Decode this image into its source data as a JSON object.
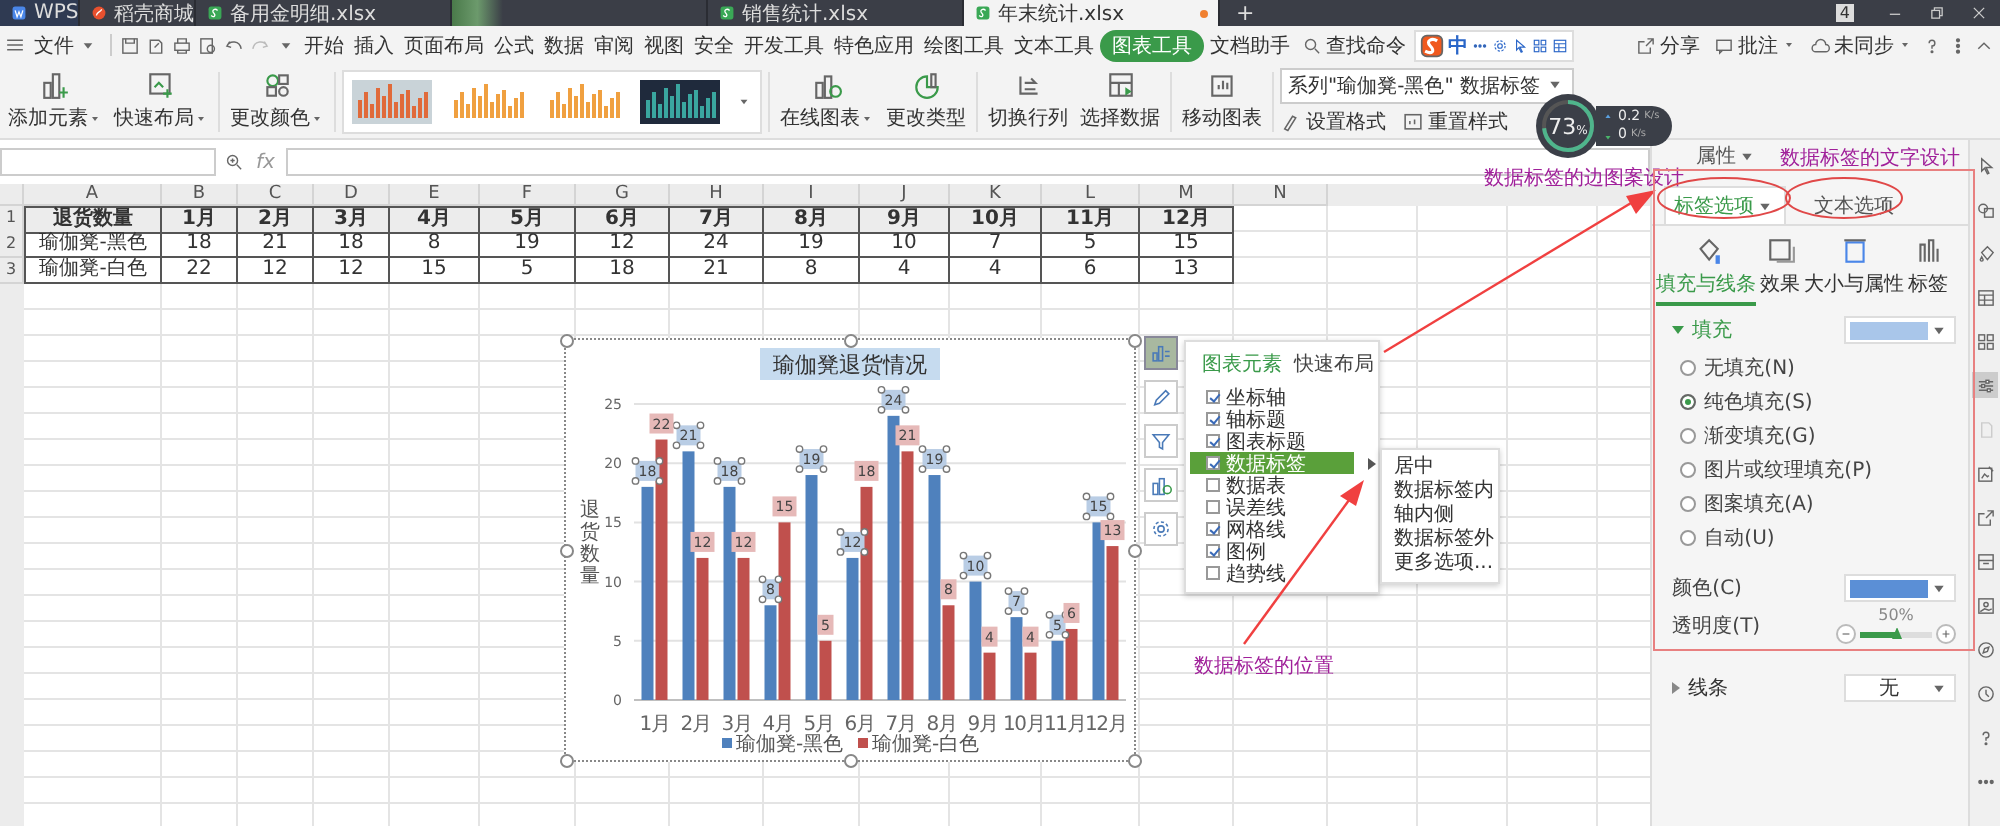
{
  "title_bar": {
    "tabs": [
      {
        "label": "WPS",
        "kind": "wps",
        "selected": false
      },
      {
        "label": "稻壳商城",
        "kind": "shop",
        "selected": false
      },
      {
        "label": "备用金明细.xlsx",
        "kind": "sheet",
        "selected": false
      },
      {
        "kind": "blurred",
        "selected": false
      },
      {
        "label": "销售统计.xlsx",
        "kind": "sheet",
        "selected": false
      },
      {
        "label": "年末统计.xlsx",
        "kind": "sheet",
        "selected": true
      }
    ],
    "new_tab": "+",
    "window_count": "4"
  },
  "menu": {
    "file": "文件",
    "tabs": [
      {
        "label": "开始",
        "selected": false
      },
      {
        "label": "插入",
        "selected": false
      },
      {
        "label": "页面布局",
        "selected": false
      },
      {
        "label": "公式",
        "selected": false
      },
      {
        "label": "数据",
        "selected": false
      },
      {
        "label": "审阅",
        "selected": false
      },
      {
        "label": "视图",
        "selected": false
      },
      {
        "label": "安全",
        "selected": false
      },
      {
        "label": "开发工具",
        "selected": false
      },
      {
        "label": "特色应用",
        "selected": false
      },
      {
        "label": "绘图工具",
        "selected": false
      },
      {
        "label": "文本工具",
        "selected": false
      },
      {
        "label": "图表工具",
        "selected": true
      },
      {
        "label": "文档助手",
        "selected": false
      }
    ],
    "search": "查找命令",
    "actions": [
      {
        "label": "分享",
        "kind": "share",
        "menu": false
      },
      {
        "label": "批注",
        "kind": "comment",
        "menu": true
      },
      {
        "label": "未同步",
        "kind": "cloud",
        "menu": true
      }
    ]
  },
  "ime_bar": {
    "mode": "中"
  },
  "ribbon": {
    "groups": [
      [
        {
          "label": "添加元素",
          "kind": "add-element",
          "menu": true
        },
        {
          "label": "快速布局",
          "kind": "layout",
          "menu": true
        }
      ],
      [
        {
          "label": "更改颜色",
          "kind": "color",
          "menu": true
        }
      ],
      [
        {
          "kind": "gallery"
        }
      ],
      [
        {
          "label": "在线图表",
          "kind": "online",
          "menu": true
        },
        {
          "label": "更改类型",
          "kind": "type",
          "menu": false
        }
      ],
      [
        {
          "label": "切换行列",
          "kind": "switch",
          "menu": false
        },
        {
          "label": "选择数据",
          "kind": "data",
          "menu": false
        }
      ],
      [
        {
          "label": "移动图表",
          "kind": "move",
          "menu": false
        }
      ]
    ],
    "styles": [
      {
        "kind": "gray"
      },
      {
        "kind": "white"
      },
      {
        "kind": "white"
      },
      {
        "kind": "dark"
      }
    ],
    "series_select": "系列\"瑜伽凳-黑色\" 数据标签",
    "small_buttons": [
      {
        "label": "设置格式",
        "kind": "format"
      },
      {
        "label": "重置样式",
        "kind": "reset"
      }
    ]
  },
  "formula_bar": {
    "function_label": "fx"
  },
  "sheet": {
    "columns": [
      "A",
      "B",
      "C",
      "D",
      "E",
      "F",
      "G",
      "H",
      "I",
      "J",
      "K",
      "L",
      "M",
      "N"
    ],
    "rows": [
      {
        "number": "1",
        "header": true,
        "cells": [
          "退货数量",
          "1月",
          "2月",
          "3月",
          "4月",
          "5月",
          "6月",
          "7月",
          "8月",
          "9月",
          "10月",
          "11月",
          "12月"
        ]
      },
      {
        "number": "2",
        "header": false,
        "cells": [
          "瑜伽凳-黑色",
          "18",
          "21",
          "18",
          "8",
          "19",
          "12",
          "24",
          "19",
          "10",
          "7",
          "5",
          "15"
        ]
      },
      {
        "number": "3",
        "header": false,
        "cells": [
          "瑜伽凳-白色",
          "22",
          "12",
          "12",
          "15",
          "5",
          "18",
          "21",
          "8",
          "4",
          "4",
          "6",
          "13"
        ]
      }
    ]
  },
  "chart": {
    "chart_data": {
      "type": "bar",
      "title": "瑜伽凳退货情况",
      "ylabel": "退货数量",
      "categories": [
        "1月",
        "2月",
        "3月",
        "4月",
        "5月",
        "6月",
        "7月",
        "8月",
        "9月",
        "10月",
        "11月",
        "12月"
      ],
      "series": [
        {
          "name": "瑜伽凳-黑色",
          "color": "#4f81bd",
          "values": [
            18,
            21,
            18,
            8,
            19,
            12,
            24,
            19,
            10,
            7,
            5,
            15
          ]
        },
        {
          "name": "瑜伽凳-白色",
          "color": "#c0504d",
          "values": [
            22,
            12,
            12,
            15,
            5,
            18,
            21,
            8,
            4,
            4,
            6,
            13
          ]
        }
      ],
      "ylim": [
        0,
        25
      ],
      "yticks": [
        {
          "value": 0,
          "label": "0"
        },
        {
          "value": 5,
          "label": "5"
        },
        {
          "value": 10,
          "label": "10"
        },
        {
          "value": 15,
          "label": "15"
        },
        {
          "value": 20,
          "label": "20"
        },
        {
          "value": 25,
          "label": "25"
        }
      ],
      "data_labels": true,
      "grid": true,
      "legend": true
    },
    "value_labels": [
      [
        "18",
        "21",
        "18",
        "8",
        "19",
        "12",
        "24",
        "19",
        "10",
        "7",
        "5",
        "15"
      ],
      [
        "22",
        "12",
        "12",
        "15",
        "5",
        "18",
        "21",
        "8",
        "4",
        "4",
        "6",
        "13"
      ]
    ],
    "label_selection": [
      {
        "selected": true
      },
      {
        "selected": false
      }
    ]
  },
  "chart_tools": {
    "icons": [
      {
        "kind": "elements",
        "selected": true
      },
      {
        "kind": "style",
        "selected": false
      },
      {
        "kind": "filter",
        "selected": false
      },
      {
        "kind": "online",
        "selected": false
      },
      {
        "kind": "settings",
        "selected": false
      }
    ],
    "tabs": [
      {
        "label": "图表元素",
        "selected": true
      },
      {
        "label": "快速布局",
        "selected": false
      }
    ],
    "items": [
      {
        "label": "坐标轴",
        "checked": true,
        "selected": false
      },
      {
        "label": "轴标题",
        "checked": true,
        "selected": false
      },
      {
        "label": "图表标题",
        "checked": true,
        "selected": false
      },
      {
        "label": "数据标签",
        "checked": true,
        "selected": true
      },
      {
        "label": "数据表",
        "checked": false,
        "selected": false
      },
      {
        "label": "误差线",
        "checked": false,
        "selected": false
      },
      {
        "label": "网格线",
        "checked": true,
        "selected": false
      },
      {
        "label": "图例",
        "checked": true,
        "selected": false
      },
      {
        "label": "趋势线",
        "checked": false,
        "selected": false
      }
    ],
    "submenu": [
      "居中",
      "数据标签内",
      "轴内侧",
      "数据标签外",
      "更多选项..."
    ]
  },
  "net_speed": {
    "percent": "73",
    "unit": "%",
    "upload": "0.2",
    "upload_unit": "K/s",
    "download": "0",
    "download_unit": "K/s"
  },
  "panel": {
    "title": "属性",
    "tabs": [
      {
        "label": "标签选项",
        "selected": true
      },
      {
        "label": "文本选项",
        "selected": false
      }
    ],
    "subtabs": [
      {
        "label": "填充与线条",
        "kind": "fill",
        "selected": true
      },
      {
        "label": "效果",
        "kind": "effect",
        "selected": false
      },
      {
        "label": "大小与属性",
        "kind": "size",
        "selected": false
      },
      {
        "label": "标签",
        "kind": "label",
        "selected": false
      }
    ],
    "fill": {
      "label": "填充",
      "expanded": true,
      "color": "#a9c6ea",
      "options": [
        {
          "label": "无填充(N)",
          "selected": false
        },
        {
          "label": "纯色填充(S)",
          "selected": true
        },
        {
          "label": "渐变填充(G)",
          "selected": false
        },
        {
          "label": "图片或纹理填充(P)",
          "selected": false
        },
        {
          "label": "图案填充(A)",
          "selected": false
        },
        {
          "label": "自动(U)",
          "selected": false
        }
      ],
      "color_field": {
        "label": "颜色(C)",
        "color": "#5b8fd6"
      },
      "transparency_label": "透明度(T)",
      "transparency": "50%",
      "level": 0.5
    },
    "line": {
      "label": "线条",
      "expanded": false,
      "value": "无"
    },
    "side_icons": [
      {
        "kind": "cursor",
        "selected": false
      },
      {
        "kind": "shapes",
        "selected": false
      },
      {
        "kind": "bucket",
        "selected": false
      },
      {
        "kind": "table",
        "selected": false
      },
      {
        "kind": "grid",
        "selected": false
      },
      {
        "kind": "sliders",
        "selected": true
      },
      {
        "kind": "doc",
        "selected": false
      },
      {
        "kind": "image-edit",
        "selected": false
      },
      {
        "kind": "share",
        "selected": false
      },
      {
        "kind": "archive",
        "selected": false
      },
      {
        "kind": "picture",
        "selected": false
      },
      {
        "kind": "compass",
        "selected": false
      },
      {
        "kind": "history",
        "selected": false
      },
      {
        "kind": "help",
        "selected": false
      },
      {
        "kind": "more",
        "selected": false
      }
    ]
  },
  "annotations": [
    {
      "text": "数据标签的边图案设计"
    },
    {
      "text": "数据标签的文字设计"
    },
    {
      "text": "数据标签的位置"
    }
  ]
}
